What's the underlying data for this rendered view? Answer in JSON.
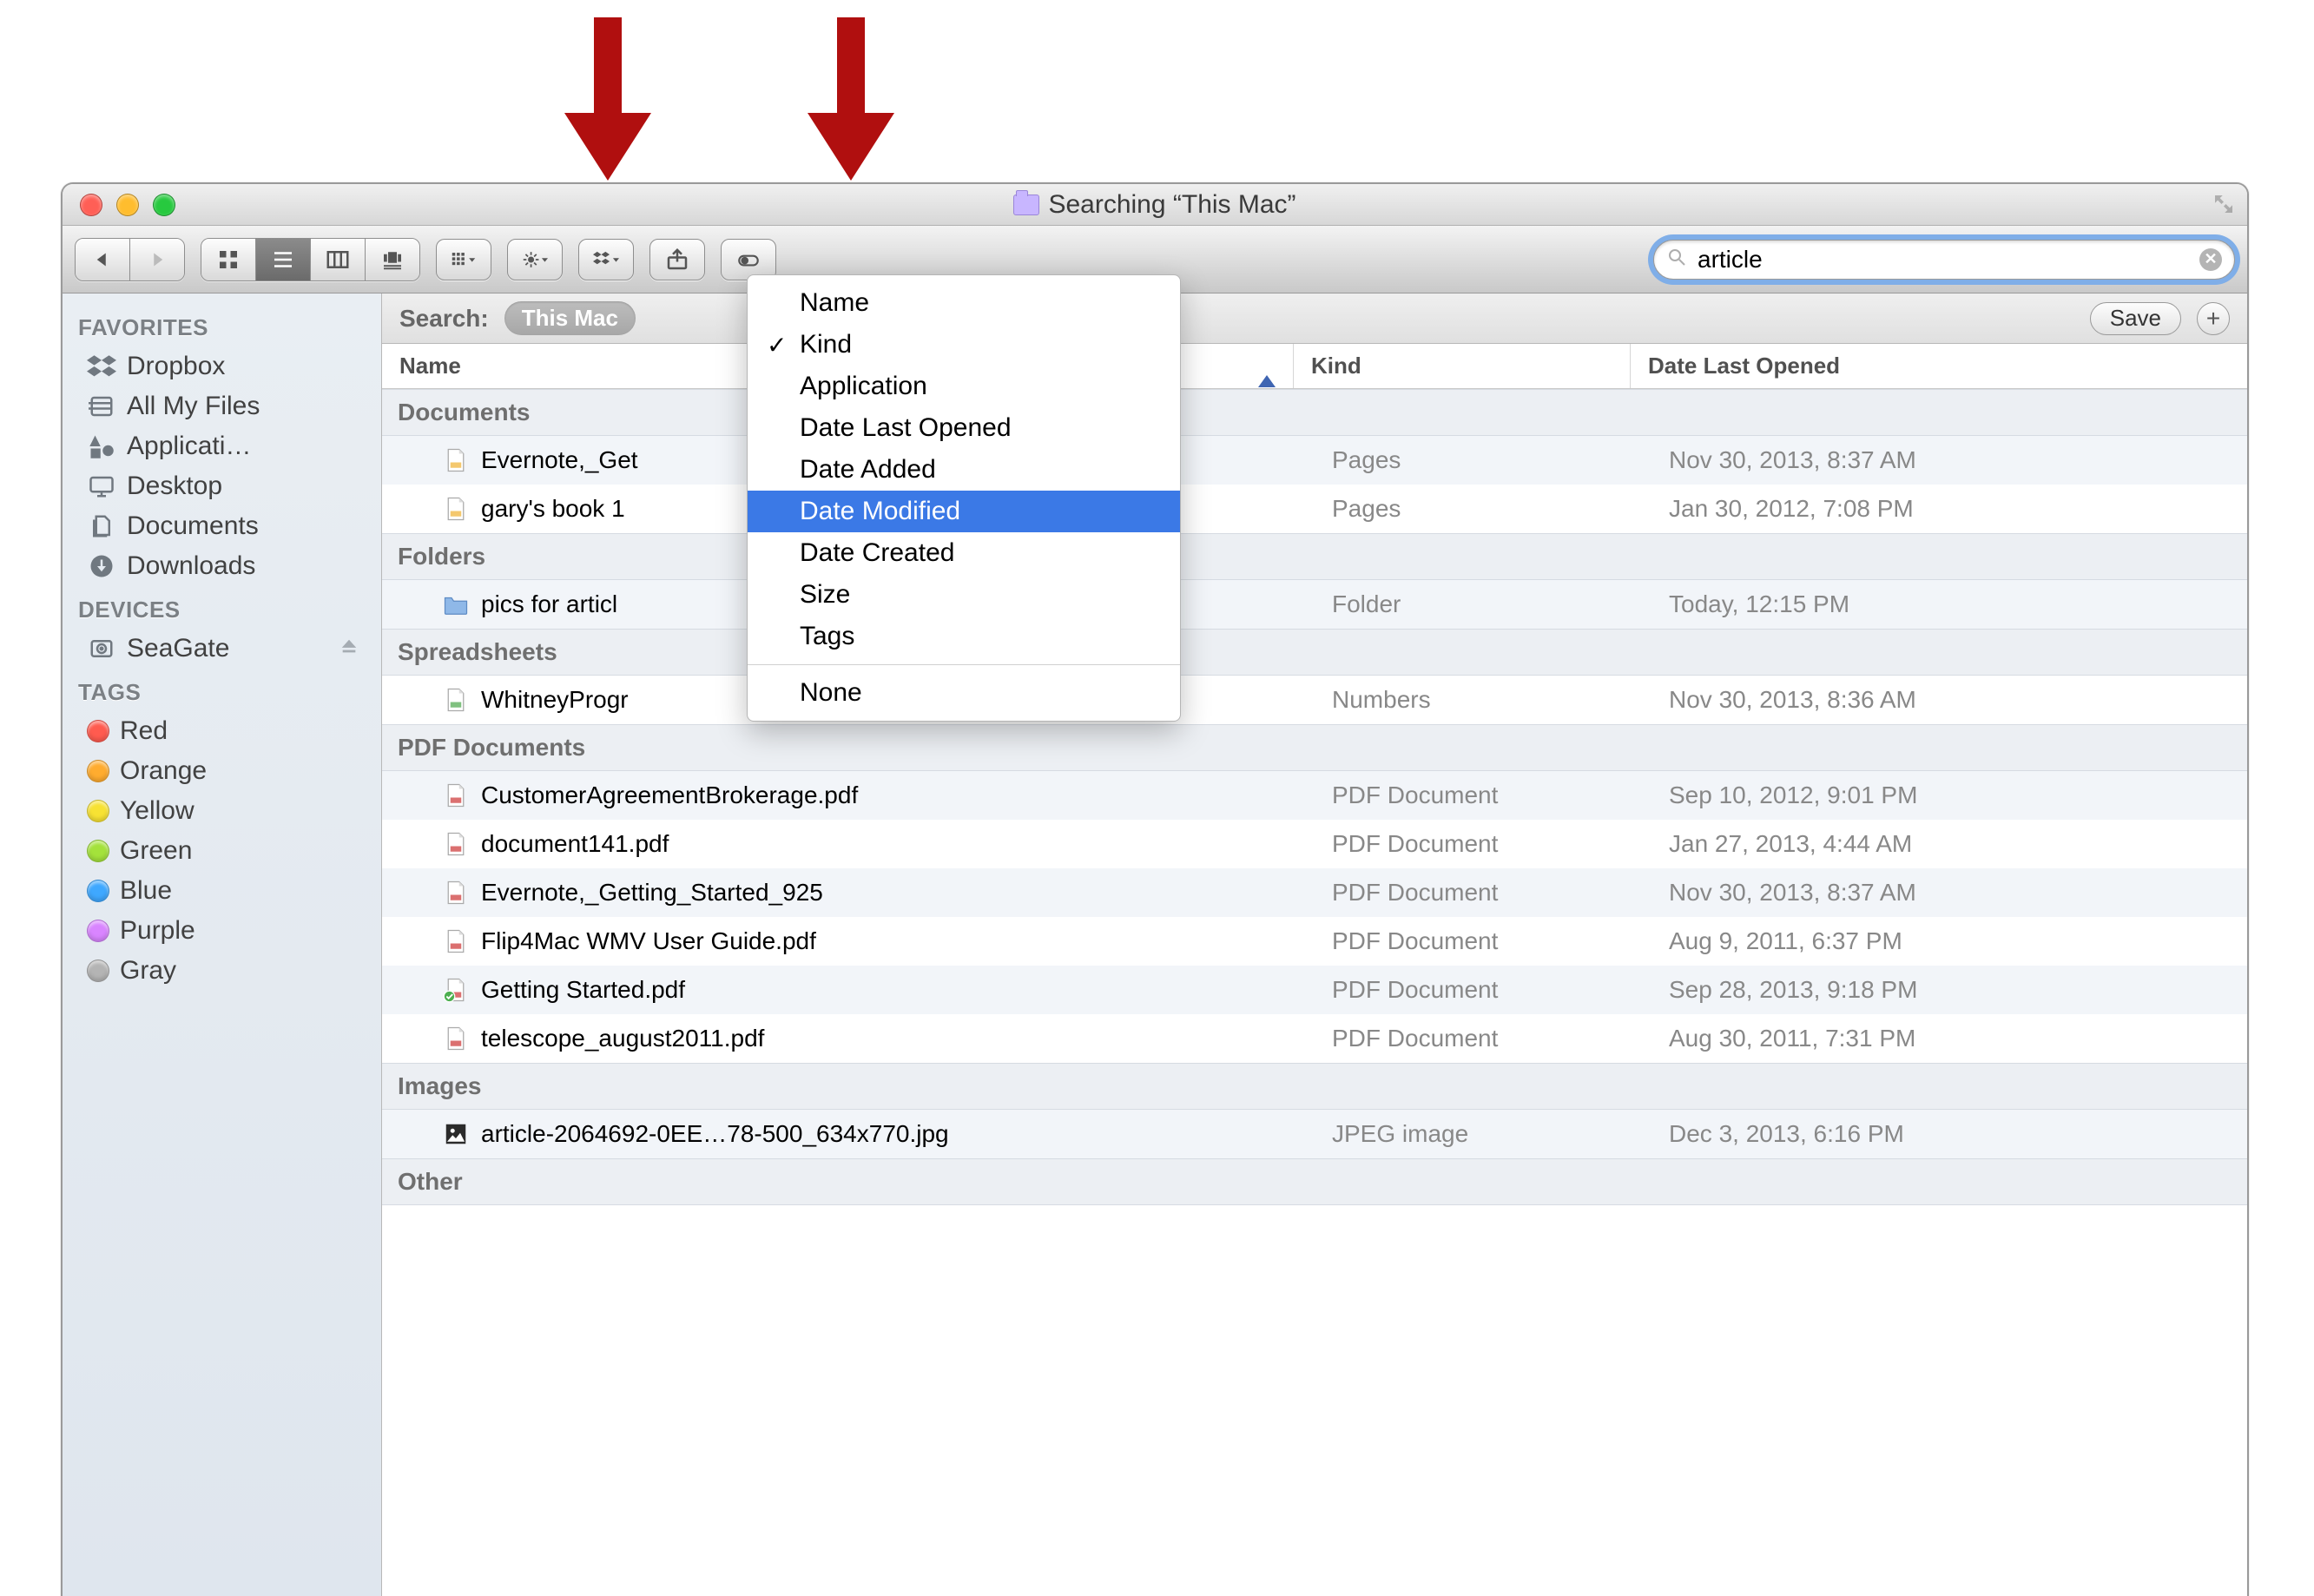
{
  "window": {
    "title": "Searching “This Mac”"
  },
  "search": {
    "placeholder": "Search",
    "value": "article"
  },
  "search_scope": {
    "label": "Search:",
    "active": "This Mac",
    "save_label": "Save"
  },
  "columns": {
    "name": "Name",
    "kind": "Kind",
    "date": "Date Last Opened"
  },
  "sidebar": {
    "sections": [
      {
        "header": "FAVORITES",
        "items": [
          {
            "icon": "dropbox",
            "label": "Dropbox"
          },
          {
            "icon": "allmyfiles",
            "label": "All My Files"
          },
          {
            "icon": "applications",
            "label": "Applicati…"
          },
          {
            "icon": "desktop",
            "label": "Desktop"
          },
          {
            "icon": "documents",
            "label": "Documents"
          },
          {
            "icon": "downloads",
            "label": "Downloads"
          }
        ]
      },
      {
        "header": "DEVICES",
        "items": [
          {
            "icon": "disk",
            "label": "SeaGate",
            "eject": true
          }
        ]
      },
      {
        "header": "TAGS",
        "items": [
          {
            "color": "#ff5b4f",
            "label": "Red"
          },
          {
            "color": "#ffac2f",
            "label": "Orange"
          },
          {
            "color": "#f7e233",
            "label": "Yellow"
          },
          {
            "color": "#a4e23b",
            "label": "Green"
          },
          {
            "color": "#3fa8ff",
            "label": "Blue"
          },
          {
            "color": "#d985ff",
            "label": "Purple"
          },
          {
            "color": "#b4b4b4",
            "label": "Gray"
          }
        ]
      }
    ]
  },
  "arrange_menu": {
    "items": [
      {
        "label": "Name"
      },
      {
        "label": "Kind",
        "checked": true
      },
      {
        "label": "Application"
      },
      {
        "label": "Date Last Opened"
      },
      {
        "label": "Date Added"
      },
      {
        "label": "Date Modified",
        "highlighted": true
      },
      {
        "label": "Date Created"
      },
      {
        "label": "Size"
      },
      {
        "label": "Tags"
      }
    ],
    "footer": "None"
  },
  "results": [
    {
      "group": "Documents",
      "rows": [
        {
          "icon": "pages",
          "name": "Evernote,_Get",
          "kind": "Pages",
          "date": "Nov 30, 2013, 8:37 AM",
          "alt": true
        },
        {
          "icon": "pages",
          "name": "gary's book 1",
          "kind": "Pages",
          "date": "Jan 30, 2012, 7:08 PM",
          "alt": false
        }
      ]
    },
    {
      "group": "Folders",
      "rows": [
        {
          "icon": "folder",
          "name": "pics for articl",
          "kind": "Folder",
          "date": "Today, 12:15 PM",
          "alt": true
        }
      ]
    },
    {
      "group": "Spreadsheets",
      "rows": [
        {
          "icon": "numbers",
          "name": "WhitneyProgr",
          "kind": "Numbers",
          "date": "Nov 30, 2013, 8:36 AM",
          "alt": false
        }
      ]
    },
    {
      "group": "PDF Documents",
      "rows": [
        {
          "icon": "pdf",
          "name": "CustomerAgreementBrokerage.pdf",
          "kind": "PDF Document",
          "date": "Sep 10, 2012, 9:01 PM",
          "alt": true
        },
        {
          "icon": "pdf",
          "name": "document141.pdf",
          "kind": "PDF Document",
          "date": "Jan 27, 2013, 4:44 AM",
          "alt": false
        },
        {
          "icon": "pdf",
          "name": "Evernote,_Getting_Started_925",
          "kind": "PDF Document",
          "date": "Nov 30, 2013, 8:37 AM",
          "alt": true
        },
        {
          "icon": "pdf",
          "name": "Flip4Mac WMV User Guide.pdf",
          "kind": "PDF Document",
          "date": "Aug 9, 2011, 6:37 PM",
          "alt": false
        },
        {
          "icon": "pdf",
          "name": "Getting Started.pdf",
          "kind": "PDF Document",
          "date": "Sep 28, 2013, 9:18 PM",
          "alt": true,
          "badge": true
        },
        {
          "icon": "pdf",
          "name": "telescope_august2011.pdf",
          "kind": "PDF Document",
          "date": "Aug 30, 2011, 7:31 PM",
          "alt": false
        }
      ]
    },
    {
      "group": "Images",
      "rows": [
        {
          "icon": "image",
          "name": "article-2064692-0EE…78-500_634x770.jpg",
          "kind": "JPEG image",
          "date": "Dec 3, 2013, 6:16 PM",
          "alt": true
        }
      ]
    },
    {
      "group": "Other",
      "rows": []
    }
  ]
}
